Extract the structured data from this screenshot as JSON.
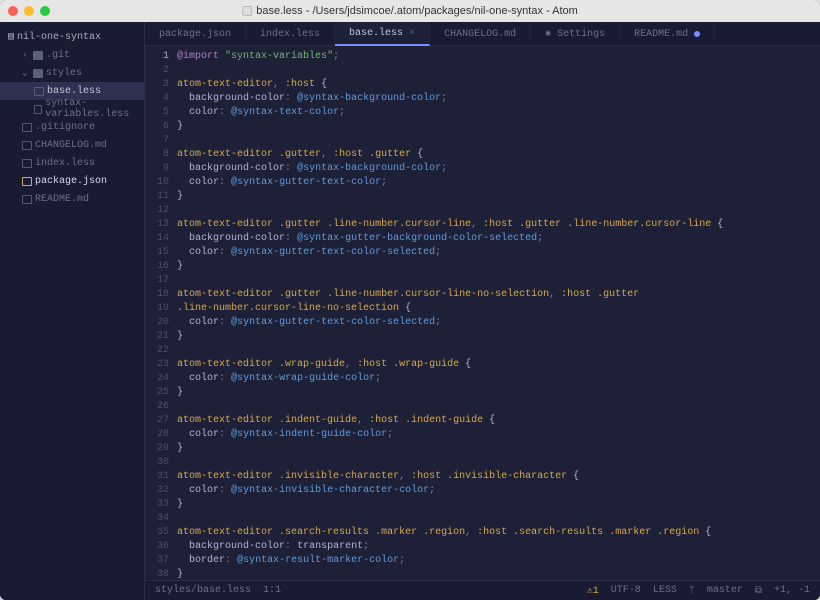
{
  "window": {
    "title": "base.less - /Users/jdsimcoe/.atom/packages/nil-one-syntax - Atom"
  },
  "sidebar": {
    "root": "nil-one-syntax",
    "items": [
      {
        "label": ".git",
        "type": "folder",
        "level": 1,
        "expanded": false
      },
      {
        "label": "styles",
        "type": "folder",
        "level": 1,
        "expanded": true
      },
      {
        "label": "base.less",
        "type": "file",
        "level": 2,
        "selected": true
      },
      {
        "label": "syntax-variables.less",
        "type": "file",
        "level": 2
      },
      {
        "label": ".gitignore",
        "type": "file",
        "level": 1
      },
      {
        "label": "CHANGELOG.md",
        "type": "file",
        "level": 1
      },
      {
        "label": "index.less",
        "type": "file",
        "level": 1
      },
      {
        "label": "package.json",
        "type": "file",
        "level": 1,
        "modified": true
      },
      {
        "label": "README.md",
        "type": "file",
        "level": 1
      }
    ]
  },
  "tabs": [
    {
      "label": "package.json"
    },
    {
      "label": "index.less"
    },
    {
      "label": "base.less",
      "active": true
    },
    {
      "label": "CHANGELOG.md"
    },
    {
      "label": "Settings",
      "icon": "gear"
    },
    {
      "label": "README.md",
      "modified": true
    }
  ],
  "code_lines": [
    [
      {
        "t": "@import",
        "c": "kw"
      },
      {
        "t": " ",
        "c": "punc"
      },
      {
        "t": "\"syntax-variables\"",
        "c": "str"
      },
      {
        "t": ";",
        "c": "punc"
      }
    ],
    [],
    [
      {
        "t": "atom-text-editor",
        "c": "sel-css"
      },
      {
        "t": ", ",
        "c": "punc"
      },
      {
        "t": ":host",
        "c": "sel-css"
      },
      {
        "t": " {",
        "c": "brace"
      }
    ],
    [
      {
        "t": "  ",
        "c": ""
      },
      {
        "t": "background-color",
        "c": "prop"
      },
      {
        "t": ": ",
        "c": "punc"
      },
      {
        "t": "@syntax-background-color",
        "c": "var"
      },
      {
        "t": ";",
        "c": "punc"
      }
    ],
    [
      {
        "t": "  ",
        "c": ""
      },
      {
        "t": "color",
        "c": "prop"
      },
      {
        "t": ": ",
        "c": "punc"
      },
      {
        "t": "@syntax-text-color",
        "c": "var"
      },
      {
        "t": ";",
        "c": "punc"
      }
    ],
    [
      {
        "t": "}",
        "c": "brace"
      }
    ],
    [],
    [
      {
        "t": "atom-text-editor",
        "c": "sel-css"
      },
      {
        "t": " ",
        "c": ""
      },
      {
        "t": ".gutter",
        "c": "sel-css"
      },
      {
        "t": ", ",
        "c": "punc"
      },
      {
        "t": ":host",
        "c": "sel-css"
      },
      {
        "t": " ",
        "c": ""
      },
      {
        "t": ".gutter",
        "c": "sel-css"
      },
      {
        "t": " {",
        "c": "brace"
      }
    ],
    [
      {
        "t": "  ",
        "c": ""
      },
      {
        "t": "background-color",
        "c": "prop"
      },
      {
        "t": ": ",
        "c": "punc"
      },
      {
        "t": "@syntax-background-color",
        "c": "var"
      },
      {
        "t": ";",
        "c": "punc"
      }
    ],
    [
      {
        "t": "  ",
        "c": ""
      },
      {
        "t": "color",
        "c": "prop"
      },
      {
        "t": ": ",
        "c": "punc"
      },
      {
        "t": "@syntax-gutter-text-color",
        "c": "var"
      },
      {
        "t": ";",
        "c": "punc"
      }
    ],
    [
      {
        "t": "}",
        "c": "brace"
      }
    ],
    [],
    [
      {
        "t": "atom-text-editor",
        "c": "sel-css"
      },
      {
        "t": " ",
        "c": ""
      },
      {
        "t": ".gutter",
        "c": "sel-css"
      },
      {
        "t": " ",
        "c": ""
      },
      {
        "t": ".line-number.cursor-line",
        "c": "sel-css"
      },
      {
        "t": ", ",
        "c": "punc"
      },
      {
        "t": ":host",
        "c": "sel-css"
      },
      {
        "t": " ",
        "c": ""
      },
      {
        "t": ".gutter",
        "c": "sel-css"
      },
      {
        "t": " ",
        "c": ""
      },
      {
        "t": ".line-number.cursor-line",
        "c": "sel-css"
      },
      {
        "t": " {",
        "c": "brace"
      }
    ],
    [
      {
        "t": "  ",
        "c": ""
      },
      {
        "t": "background-color",
        "c": "prop"
      },
      {
        "t": ": ",
        "c": "punc"
      },
      {
        "t": "@syntax-gutter-background-color-selected",
        "c": "var"
      },
      {
        "t": ";",
        "c": "punc"
      }
    ],
    [
      {
        "t": "  ",
        "c": ""
      },
      {
        "t": "color",
        "c": "prop"
      },
      {
        "t": ": ",
        "c": "punc"
      },
      {
        "t": "@syntax-gutter-text-color-selected",
        "c": "var"
      },
      {
        "t": ";",
        "c": "punc"
      }
    ],
    [
      {
        "t": "}",
        "c": "brace"
      }
    ],
    [],
    [
      {
        "t": "atom-text-editor",
        "c": "sel-css"
      },
      {
        "t": " ",
        "c": ""
      },
      {
        "t": ".gutter",
        "c": "sel-css"
      },
      {
        "t": " ",
        "c": ""
      },
      {
        "t": ".line-number.cursor-line-no-selection",
        "c": "sel-css"
      },
      {
        "t": ", ",
        "c": "punc"
      },
      {
        "t": ":host",
        "c": "sel-css"
      },
      {
        "t": " ",
        "c": ""
      },
      {
        "t": ".gutter",
        "c": "sel-css"
      }
    ],
    [
      {
        "t": ".line-number.cursor-line-no-selection",
        "c": "sel-css"
      },
      {
        "t": " {",
        "c": "brace"
      }
    ],
    [
      {
        "t": "  ",
        "c": ""
      },
      {
        "t": "color",
        "c": "prop"
      },
      {
        "t": ": ",
        "c": "punc"
      },
      {
        "t": "@syntax-gutter-text-color-selected",
        "c": "var"
      },
      {
        "t": ";",
        "c": "punc"
      }
    ],
    [
      {
        "t": "}",
        "c": "brace"
      }
    ],
    [],
    [
      {
        "t": "atom-text-editor",
        "c": "sel-css"
      },
      {
        "t": " ",
        "c": ""
      },
      {
        "t": ".wrap-guide",
        "c": "sel-css"
      },
      {
        "t": ", ",
        "c": "punc"
      },
      {
        "t": ":host",
        "c": "sel-css"
      },
      {
        "t": " ",
        "c": ""
      },
      {
        "t": ".wrap-guide",
        "c": "sel-css"
      },
      {
        "t": " {",
        "c": "brace"
      }
    ],
    [
      {
        "t": "  ",
        "c": ""
      },
      {
        "t": "color",
        "c": "prop"
      },
      {
        "t": ": ",
        "c": "punc"
      },
      {
        "t": "@syntax-wrap-guide-color",
        "c": "var"
      },
      {
        "t": ";",
        "c": "punc"
      }
    ],
    [
      {
        "t": "}",
        "c": "brace"
      }
    ],
    [],
    [
      {
        "t": "atom-text-editor",
        "c": "sel-css"
      },
      {
        "t": " ",
        "c": ""
      },
      {
        "t": ".indent-guide",
        "c": "sel-css"
      },
      {
        "t": ", ",
        "c": "punc"
      },
      {
        "t": ":host",
        "c": "sel-css"
      },
      {
        "t": " ",
        "c": ""
      },
      {
        "t": ".indent-guide",
        "c": "sel-css"
      },
      {
        "t": " {",
        "c": "brace"
      }
    ],
    [
      {
        "t": "  ",
        "c": ""
      },
      {
        "t": "color",
        "c": "prop"
      },
      {
        "t": ": ",
        "c": "punc"
      },
      {
        "t": "@syntax-indent-guide-color",
        "c": "var"
      },
      {
        "t": ";",
        "c": "punc"
      }
    ],
    [
      {
        "t": "}",
        "c": "brace"
      }
    ],
    [],
    [
      {
        "t": "atom-text-editor",
        "c": "sel-css"
      },
      {
        "t": " ",
        "c": ""
      },
      {
        "t": ".invisible-character",
        "c": "sel-css"
      },
      {
        "t": ", ",
        "c": "punc"
      },
      {
        "t": ":host",
        "c": "sel-css"
      },
      {
        "t": " ",
        "c": ""
      },
      {
        "t": ".invisible-character",
        "c": "sel-css"
      },
      {
        "t": " {",
        "c": "brace"
      }
    ],
    [
      {
        "t": "  ",
        "c": ""
      },
      {
        "t": "color",
        "c": "prop"
      },
      {
        "t": ": ",
        "c": "punc"
      },
      {
        "t": "@syntax-invisible-character-color",
        "c": "var"
      },
      {
        "t": ";",
        "c": "punc"
      }
    ],
    [
      {
        "t": "}",
        "c": "brace"
      }
    ],
    [],
    [
      {
        "t": "atom-text-editor",
        "c": "sel-css"
      },
      {
        "t": " ",
        "c": ""
      },
      {
        "t": ".search-results",
        "c": "sel-css"
      },
      {
        "t": " ",
        "c": ""
      },
      {
        "t": ".marker",
        "c": "sel-css"
      },
      {
        "t": " ",
        "c": ""
      },
      {
        "t": ".region",
        "c": "sel-css"
      },
      {
        "t": ", ",
        "c": "punc"
      },
      {
        "t": ":host",
        "c": "sel-css"
      },
      {
        "t": " ",
        "c": ""
      },
      {
        "t": ".search-results",
        "c": "sel-css"
      },
      {
        "t": " ",
        "c": ""
      },
      {
        "t": ".marker",
        "c": "sel-css"
      },
      {
        "t": " ",
        "c": ""
      },
      {
        "t": ".region",
        "c": "sel-css"
      },
      {
        "t": " {",
        "c": "brace"
      }
    ],
    [
      {
        "t": "  ",
        "c": ""
      },
      {
        "t": "background-color",
        "c": "prop"
      },
      {
        "t": ": ",
        "c": "punc"
      },
      {
        "t": "transparent",
        "c": "prop"
      },
      {
        "t": ";",
        "c": "punc"
      }
    ],
    [
      {
        "t": "  ",
        "c": ""
      },
      {
        "t": "border",
        "c": "prop"
      },
      {
        "t": ": ",
        "c": "punc"
      },
      {
        "t": "@syntax-result-marker-color",
        "c": "var"
      },
      {
        "t": ";",
        "c": "punc"
      }
    ],
    [
      {
        "t": "}",
        "c": "brace"
      }
    ],
    []
  ],
  "cursor_line": 1,
  "status": {
    "path": "styles/base.less",
    "pos": "1:1",
    "warn": "1",
    "enc": "UTF-8",
    "lang": "LESS",
    "branch": "master",
    "diff": "+1, -1"
  }
}
